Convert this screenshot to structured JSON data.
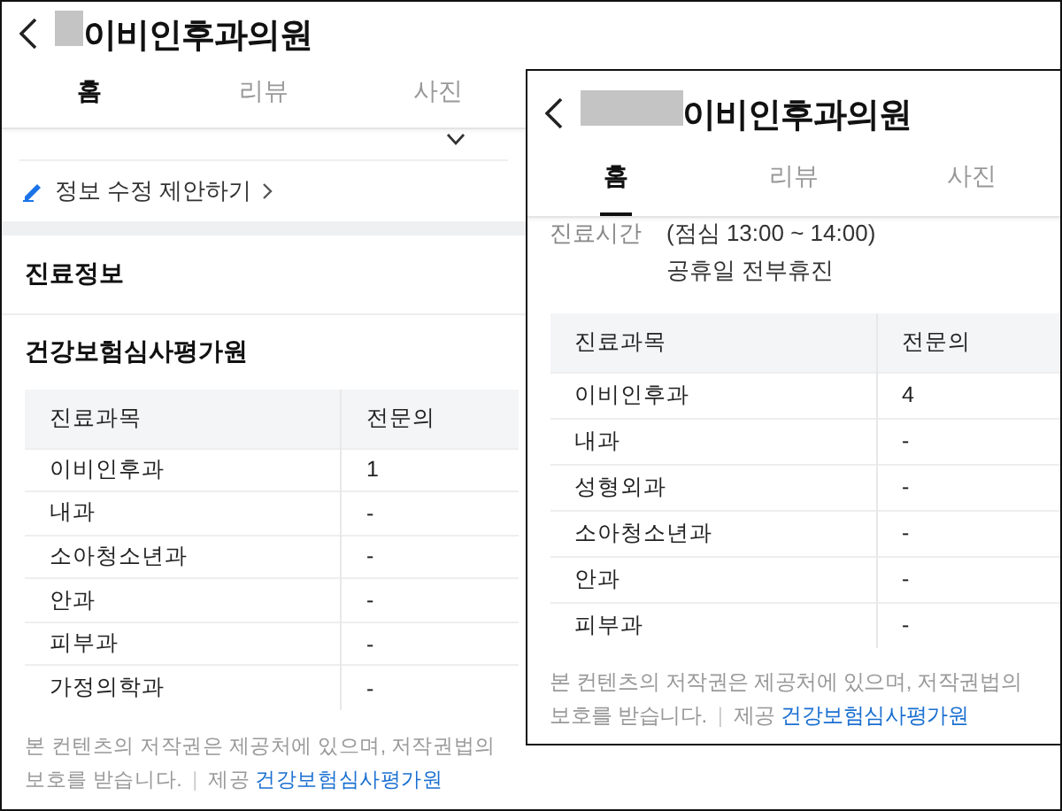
{
  "panels": [
    {
      "title": "이비인후과의원",
      "tabs": [
        {
          "label": "홈",
          "selected": true
        },
        {
          "label": "리뷰",
          "selected": false
        },
        {
          "label": "사진",
          "selected": false
        }
      ],
      "collapsed_row": {
        "expanded": false
      },
      "edit_link": "정보 수정 제안하기",
      "section_title": "진료정보",
      "source_title": "건강보험심사평가원",
      "table": {
        "columns": [
          "진료과목",
          "전문의"
        ],
        "rows": [
          [
            "이비인후과",
            "1"
          ],
          [
            "내과",
            "-"
          ],
          [
            "소아청소년과",
            "-"
          ],
          [
            "안과",
            "-"
          ],
          [
            "피부과",
            "-"
          ],
          [
            "가정의학과",
            "-"
          ]
        ]
      },
      "footer": {
        "notice": "본 컨텐츠의 저작권은 제공처에 있으며, 저작권법의 보호를 받습니다.",
        "separator": "|",
        "provider_label": "제공",
        "provider_link": "건강보험심사평가원"
      }
    },
    {
      "title": "이비인후과의원",
      "tabs": [
        {
          "label": "홈",
          "selected": true
        },
        {
          "label": "리뷰",
          "selected": false
        },
        {
          "label": "사진",
          "selected": false
        }
      ],
      "hours": {
        "label": "진료시간",
        "lines": [
          "(점심 13:00 ~ 14:00)",
          "공휴일 전부휴진"
        ]
      },
      "table": {
        "columns": [
          "진료과목",
          "전문의"
        ],
        "rows": [
          [
            "이비인후과",
            "4"
          ],
          [
            "내과",
            "-"
          ],
          [
            "성형외과",
            "-"
          ],
          [
            "소아청소년과",
            "-"
          ],
          [
            "안과",
            "-"
          ],
          [
            "피부과",
            "-"
          ]
        ]
      },
      "footer": {
        "notice": "본 컨텐츠의 저작권은 제공처에 있으며, 저작권법의 보호를 받습니다.",
        "separator": "|",
        "provider_label": "제공",
        "provider_link": "건강보험심사평가원"
      }
    }
  ]
}
